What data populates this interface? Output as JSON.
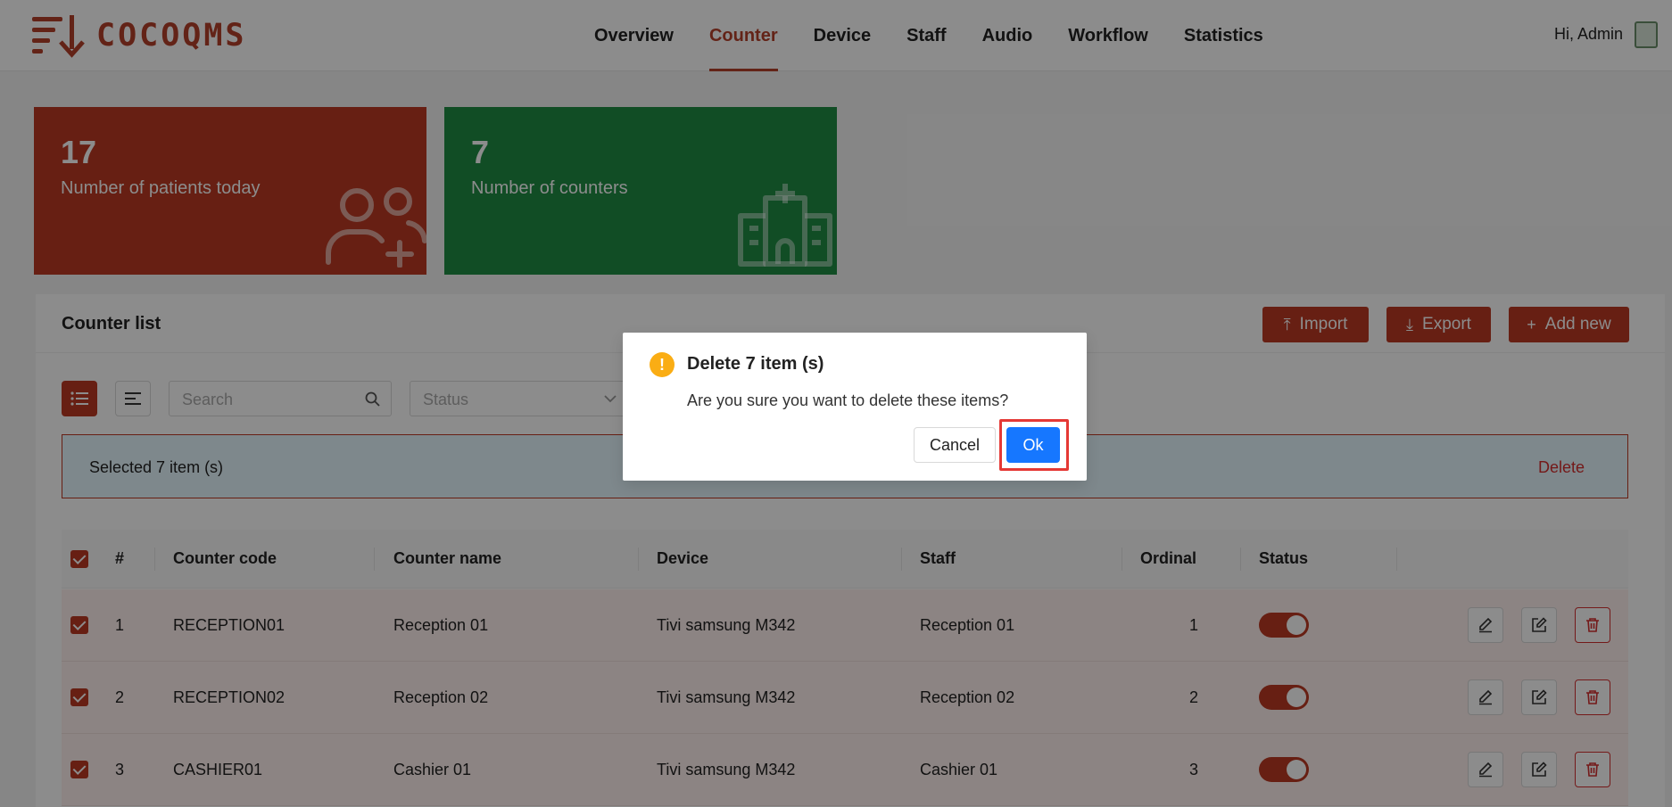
{
  "brand": {
    "name": "COCOQMS",
    "color": "#b5412b"
  },
  "nav": {
    "items": [
      {
        "label": "Overview"
      },
      {
        "label": "Counter",
        "active": true
      },
      {
        "label": "Device"
      },
      {
        "label": "Staff"
      },
      {
        "label": "Audio"
      },
      {
        "label": "Workflow"
      },
      {
        "label": "Statistics"
      }
    ]
  },
  "user": {
    "greeting": "Hi, Admin"
  },
  "stats": {
    "patients": {
      "value": "17",
      "label": "Number of patients today",
      "color": "#bc3a23",
      "icon": "users-plus-icon"
    },
    "counters": {
      "value": "7",
      "label": "Number of counters",
      "color": "#1f8d44",
      "icon": "hospital-icon"
    }
  },
  "panel": {
    "title": "Counter list",
    "buttons": {
      "import": "Import",
      "export": "Export",
      "add_new": "Add new"
    },
    "search_placeholder": "Search",
    "status_placeholder": "Status",
    "selected_text": "Selected 7 item (s)",
    "delete_label": "Delete"
  },
  "table": {
    "columns": [
      "#",
      "Counter code",
      "Counter name",
      "Device",
      "Staff",
      "Ordinal",
      "Status"
    ],
    "rows": [
      {
        "no": "1",
        "code": "RECEPTION01",
        "name": "Reception 01",
        "device": "Tivi samsung M342",
        "staff": "Reception 01",
        "ordinal": "1"
      },
      {
        "no": "2",
        "code": "RECEPTION02",
        "name": "Reception 02",
        "device": "Tivi samsung M342",
        "staff": "Reception 02",
        "ordinal": "2"
      },
      {
        "no": "3",
        "code": "CASHIER01",
        "name": "Cashier 01",
        "device": "Tivi samsung M342",
        "staff": "Cashier 01",
        "ordinal": "3"
      }
    ]
  },
  "modal": {
    "title": "Delete 7 item (s)",
    "message": "Are you sure you want to delete these items?",
    "cancel": "Cancel",
    "ok": "Ok",
    "ok_color": "#1677ff",
    "icon": "warning-icon"
  }
}
